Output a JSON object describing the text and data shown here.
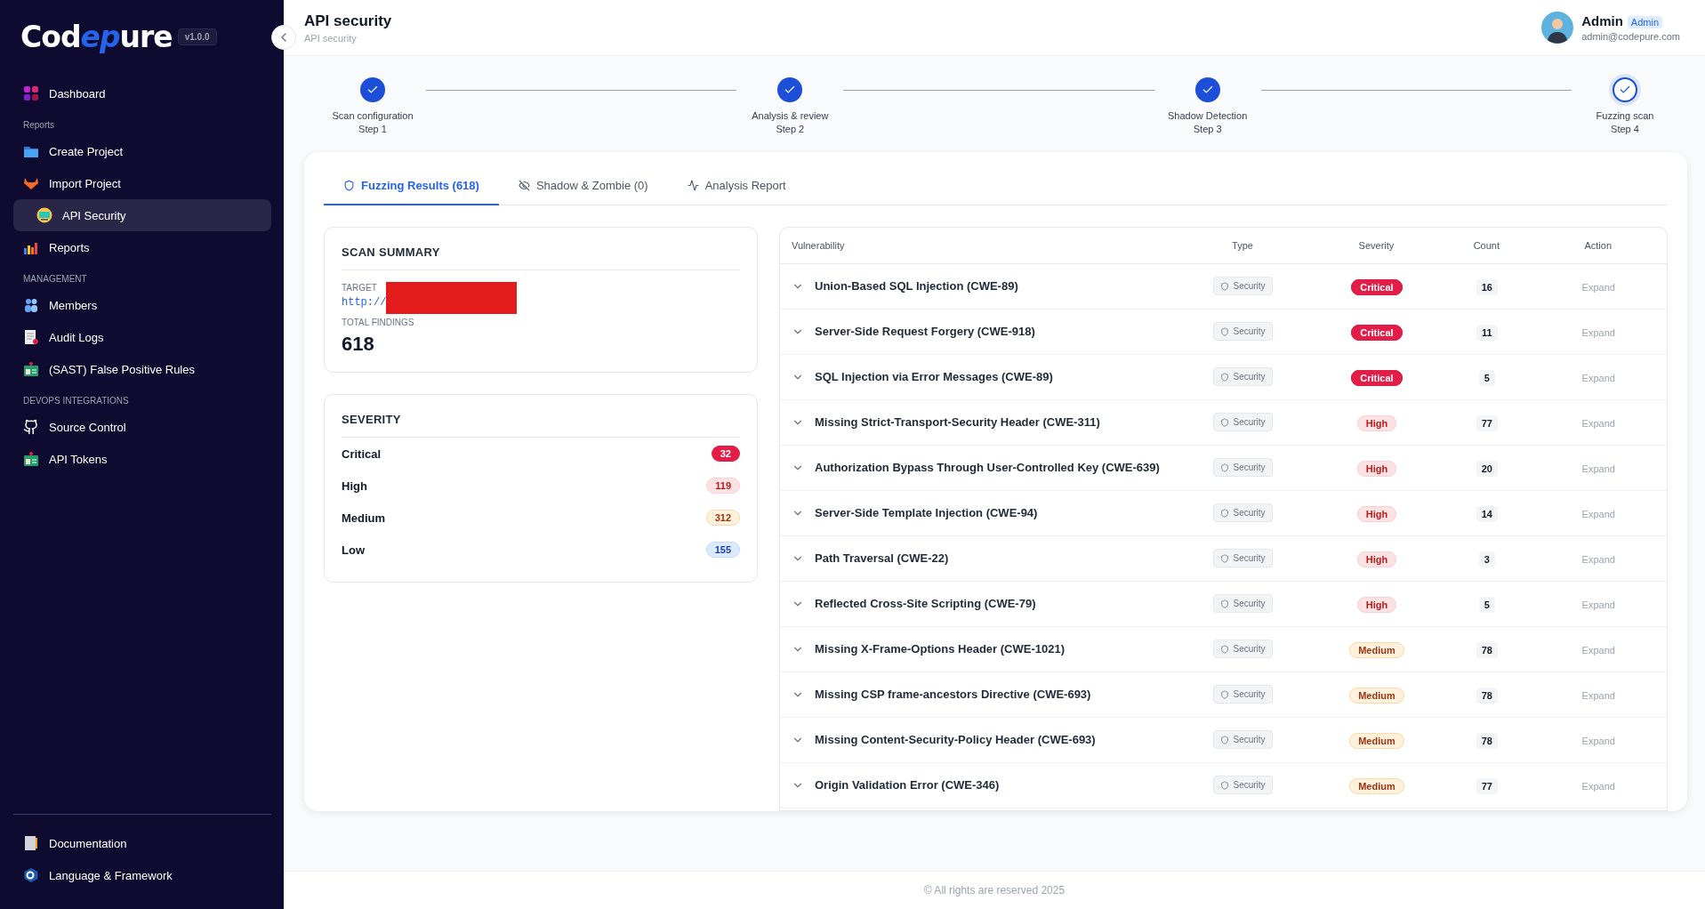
{
  "sidebar": {
    "logo": "Codepure",
    "version": "v1.0.0",
    "sections": [
      {
        "items": [
          {
            "label": "Dashboard",
            "selected": false
          }
        ]
      },
      {
        "heading": "Reports",
        "items": [
          {
            "label": "Create Project",
            "selected": false
          },
          {
            "label": "Import Project",
            "selected": false
          },
          {
            "label": "API Security",
            "selected": true
          },
          {
            "label": "Reports",
            "selected": false
          }
        ]
      },
      {
        "heading": "MANAGEMENT",
        "items": [
          {
            "label": "Members",
            "selected": false
          },
          {
            "label": "Audit Logs",
            "selected": false
          },
          {
            "label": "(SAST) False Positive Rules",
            "selected": false
          }
        ]
      },
      {
        "heading": "DEVOPS INTEGRATIONS",
        "items": [
          {
            "label": "Source Control",
            "selected": false
          },
          {
            "label": "API Tokens",
            "selected": false
          }
        ]
      }
    ],
    "footer_items": [
      {
        "label": "Documentation",
        "selected": false
      },
      {
        "label": "Language & Framework",
        "selected": false
      }
    ]
  },
  "header": {
    "title": "API security",
    "subtitle": "API security",
    "user": {
      "name": "Admin",
      "role": "Admin",
      "email": "admin@codepure.com"
    }
  },
  "stepper": [
    {
      "label": "Scan configuration",
      "step": "Step 1",
      "current": false
    },
    {
      "label": "Analysis & review",
      "step": "Step 2",
      "current": false
    },
    {
      "label": "Shadow Detection",
      "step": "Step 3",
      "current": false
    },
    {
      "label": "Fuzzing scan",
      "step": "Step 4",
      "current": true
    }
  ],
  "tabs": [
    {
      "label": "Fuzzing Results (618)",
      "selected": true
    },
    {
      "label": "Shadow & Zombie (0)",
      "selected": false
    },
    {
      "label": "Analysis Report",
      "selected": false
    }
  ],
  "scan_summary": {
    "title": "SCAN SUMMARY",
    "target_label": "TARGET",
    "target": "http://",
    "target_redacted": true,
    "total_label": "TOTAL FINDINGS",
    "total": "618"
  },
  "severity": {
    "title": "SEVERITY",
    "items": [
      {
        "label": "Critical",
        "count": "32",
        "kind": "critical"
      },
      {
        "label": "High",
        "count": "119",
        "kind": "high"
      },
      {
        "label": "Medium",
        "count": "312",
        "kind": "medium"
      },
      {
        "label": "Low",
        "count": "155",
        "kind": "low"
      }
    ]
  },
  "table": {
    "columns": [
      "Vulnerability",
      "Type",
      "Severity",
      "Count",
      "Action"
    ],
    "rows": [
      {
        "name": "Union-Based SQL Injection (CWE-89)",
        "type": "Security",
        "severity": "Critical",
        "kind": "critical",
        "count": "16",
        "action": "Expand"
      },
      {
        "name": "Server-Side Request Forgery (CWE-918)",
        "type": "Security",
        "severity": "Critical",
        "kind": "critical",
        "count": "11",
        "action": "Expand"
      },
      {
        "name": "SQL Injection via Error Messages (CWE-89)",
        "type": "Security",
        "severity": "Critical",
        "kind": "critical",
        "count": "5",
        "action": "Expand"
      },
      {
        "name": "Missing Strict-Transport-Security Header (CWE-311)",
        "type": "Security",
        "severity": "High",
        "kind": "high",
        "count": "77",
        "action": "Expand"
      },
      {
        "name": "Authorization Bypass Through User-Controlled Key (CWE-639)",
        "type": "Security",
        "severity": "High",
        "kind": "high",
        "count": "20",
        "action": "Expand"
      },
      {
        "name": "Server-Side Template Injection (CWE-94)",
        "type": "Security",
        "severity": "High",
        "kind": "high",
        "count": "14",
        "action": "Expand"
      },
      {
        "name": "Path Traversal (CWE-22)",
        "type": "Security",
        "severity": "High",
        "kind": "high",
        "count": "3",
        "action": "Expand"
      },
      {
        "name": "Reflected Cross-Site Scripting (CWE-79)",
        "type": "Security",
        "severity": "High",
        "kind": "high",
        "count": "5",
        "action": "Expand"
      },
      {
        "name": "Missing X-Frame-Options Header (CWE-1021)",
        "type": "Security",
        "severity": "Medium",
        "kind": "medium",
        "count": "78",
        "action": "Expand"
      },
      {
        "name": "Missing CSP frame-ancestors Directive (CWE-693)",
        "type": "Security",
        "severity": "Medium",
        "kind": "medium",
        "count": "78",
        "action": "Expand"
      },
      {
        "name": "Missing Content-Security-Policy Header (CWE-693)",
        "type": "Security",
        "severity": "Medium",
        "kind": "medium",
        "count": "78",
        "action": "Expand"
      },
      {
        "name": "Origin Validation Error (CWE-346)",
        "type": "Security",
        "severity": "Medium",
        "kind": "medium",
        "count": "77",
        "action": "Expand"
      }
    ]
  },
  "footer": "© All rights are reserved 2025"
}
